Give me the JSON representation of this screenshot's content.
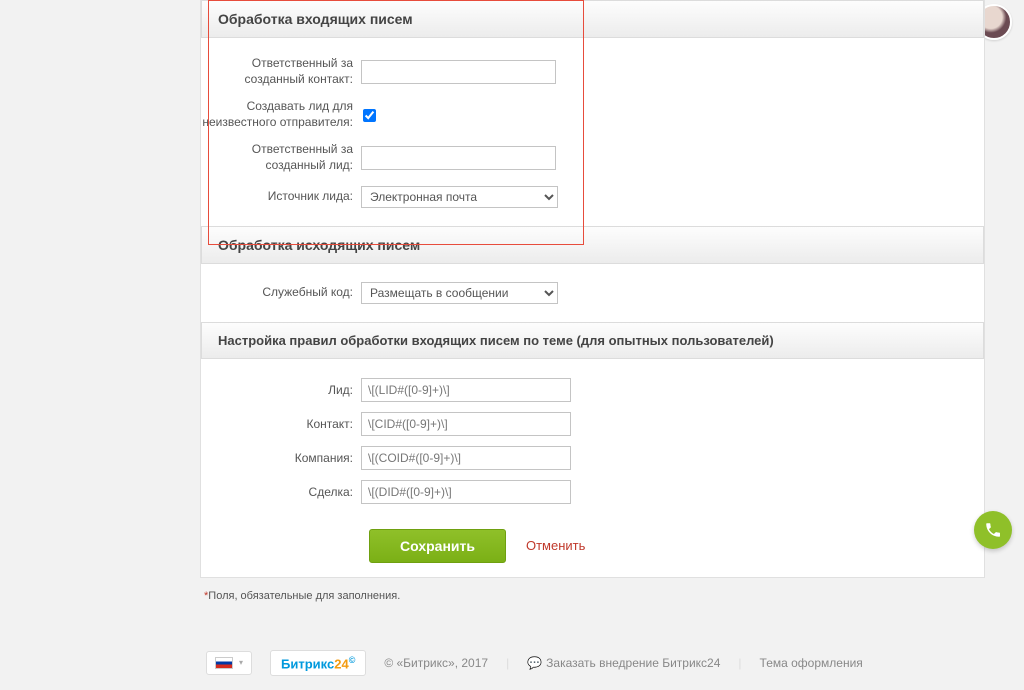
{
  "sections": {
    "incoming": {
      "title": "Обработка входящих писем",
      "responsible_contact_label": "Ответственный за созданный контакт:",
      "responsible_contact_value": "",
      "create_lead_label": "Создавать лид для неизвестного отправителя:",
      "create_lead_checked": true,
      "responsible_lead_label": "Ответственный за созданный лид:",
      "responsible_lead_value": "",
      "lead_source_label": "Источник лида:",
      "lead_source_value": "Электронная почта"
    },
    "outgoing": {
      "title": "Обработка исходящих писем",
      "service_code_label": "Служебный код:",
      "service_code_value": "Размещать в сообщении"
    },
    "advanced": {
      "title": "Настройка правил обработки входящих писем по теме (для опытных пользователей)",
      "lead_label": "Лид:",
      "lead_value": "\\[(LID#([0-9]+)\\]",
      "contact_label": "Контакт:",
      "contact_value": "\\[CID#([0-9]+)\\]",
      "company_label": "Компания:",
      "company_value": "\\[(COID#([0-9]+)\\]",
      "deal_label": "Сделка:",
      "deal_value": "\\[(DID#([0-9]+)\\]"
    }
  },
  "buttons": {
    "save": "Сохранить",
    "cancel": "Отменить"
  },
  "required_note": "Поля, обязательные для заполнения.",
  "footer": {
    "logo_main": "Битрикс",
    "logo_sub": "24",
    "copyright": "© «Битрикс», 2017",
    "adopt_link": "Заказать внедрение Битрикс24",
    "theme_link": "Тема оформления"
  }
}
